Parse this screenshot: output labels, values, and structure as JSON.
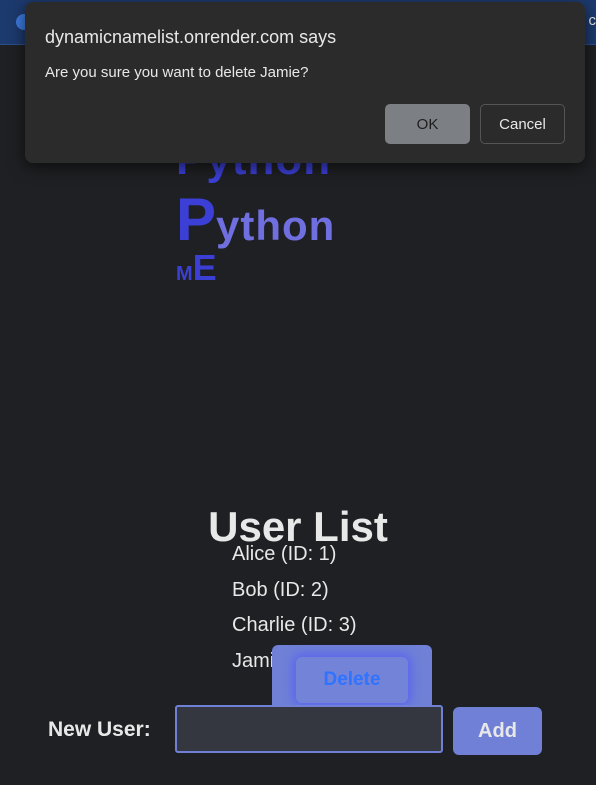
{
  "browser": {
    "right_text": "g c"
  },
  "dialog": {
    "title": "dynamicnamelist.onrender.com says",
    "message": "Are you sure you want to delete Jamie?",
    "ok_label": "OK",
    "cancel_label": "Cancel"
  },
  "logo": {
    "top_text": "Python",
    "main_p": "P",
    "main_rest": "ython",
    "me_m": "M",
    "me_e": "E"
  },
  "page": {
    "title": "User List"
  },
  "users": [
    {
      "label": "Alice (ID: 1)"
    },
    {
      "label": "Bob (ID: 2)"
    },
    {
      "label": "Charlie (ID: 3)"
    },
    {
      "label": "Jami"
    }
  ],
  "delete_popup": {
    "label": "Delete"
  },
  "form": {
    "label": "New User:",
    "input_value": "",
    "add_label": "Add"
  }
}
